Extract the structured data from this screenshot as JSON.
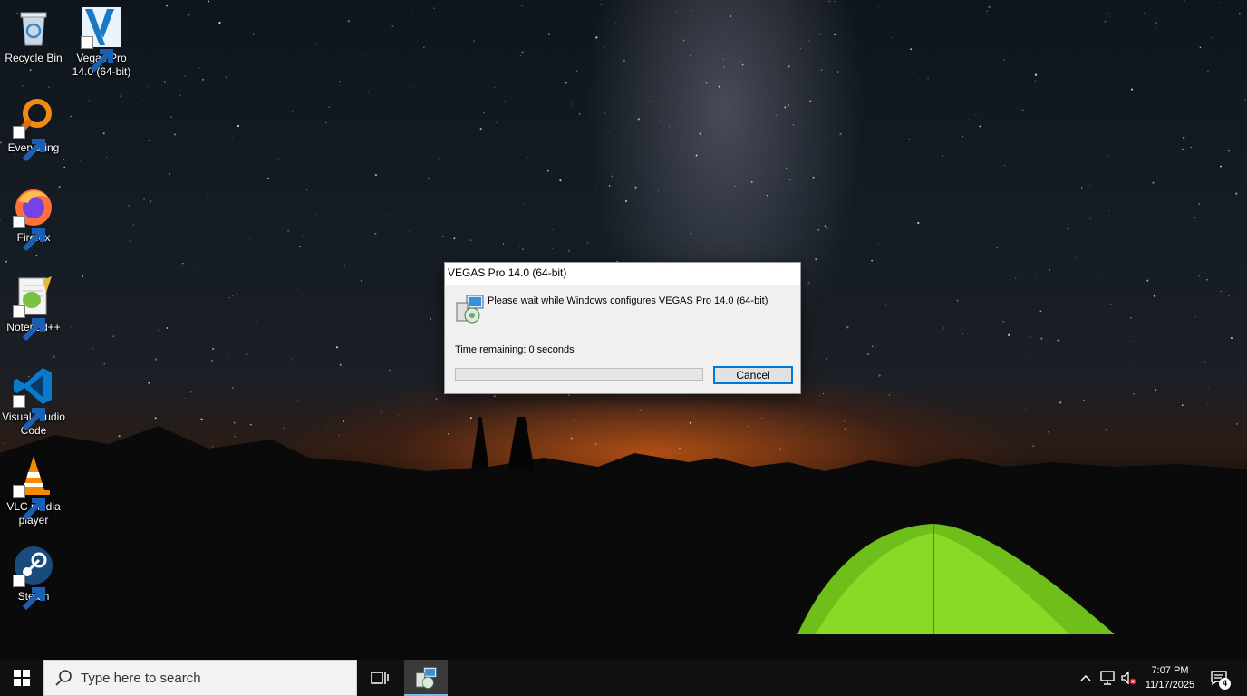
{
  "desktop": {
    "icons": [
      {
        "label": "Recycle Bin",
        "icon": "recycle-bin-icon"
      },
      {
        "label": "Vegas Pro 14.0 (64-bit)",
        "icon": "vegas-pro-icon"
      },
      {
        "label": "Everything",
        "icon": "everything-search-icon"
      },
      {
        "label": "Firefox",
        "icon": "firefox-icon"
      },
      {
        "label": "Notepad++",
        "icon": "notepad-plus-plus-icon"
      },
      {
        "label": "Visual Studio Code",
        "icon": "vscode-icon"
      },
      {
        "label": "VLC media player",
        "icon": "vlc-icon"
      },
      {
        "label": "Steam",
        "icon": "steam-icon"
      }
    ]
  },
  "dialog": {
    "title": "VEGAS Pro 14.0 (64-bit)",
    "message": "Please wait while Windows configures VEGAS Pro 14.0 (64-bit)",
    "time_remaining": "Time remaining: 0 seconds",
    "progress": 0,
    "cancel_label": "Cancel",
    "icon": "installer-icon"
  },
  "taskbar": {
    "start_icon": "windows-start-icon",
    "search_placeholder": "Type here to search",
    "task_view_icon": "task-view-icon",
    "active_app_icon": "installer-icon",
    "tray": {
      "chevron_icon": "chevron-up-icon",
      "network_icon": "network-icon",
      "volume_icon": "volume-muted-icon",
      "time": "7:07 PM",
      "date": "11/17/2025",
      "notification_icon": "action-center-icon",
      "notification_count": "4"
    }
  },
  "colors": {
    "taskbar": "#101010",
    "accent": "#0078d7",
    "dialog_bg": "#f0f0f0"
  }
}
